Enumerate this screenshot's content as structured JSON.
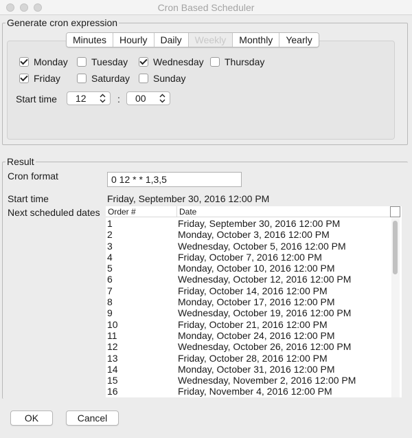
{
  "window": {
    "title": "Cron Based Scheduler"
  },
  "generate": {
    "title": "Generate cron expression",
    "tabs": [
      "Minutes",
      "Hourly",
      "Daily",
      "Weekly",
      "Monthly",
      "Yearly"
    ],
    "days": {
      "monday": "Monday",
      "tuesday": "Tuesday",
      "wednesday": "Wednesday",
      "thursday": "Thursday",
      "friday": "Friday",
      "saturday": "Saturday",
      "sunday": "Sunday"
    },
    "start_time_label": "Start time",
    "hour": "12",
    "separator": ":",
    "minute": "00"
  },
  "result": {
    "title": "Result",
    "cron_format_label": "Cron format",
    "cron_format_value": "0 12 * * 1,3,5",
    "start_time_label": "Start time",
    "start_time_value": "Friday, September 30, 2016 12:00 PM",
    "next_dates_label": "Next scheduled dates",
    "table": {
      "columns": [
        "Order #",
        "Date"
      ],
      "rows": [
        [
          "1",
          "Friday, September 30, 2016 12:00 PM"
        ],
        [
          "2",
          "Monday, October 3, 2016 12:00 PM"
        ],
        [
          "3",
          "Wednesday, October 5, 2016 12:00 PM"
        ],
        [
          "4",
          "Friday, October 7, 2016 12:00 PM"
        ],
        [
          "5",
          "Monday, October 10, 2016 12:00 PM"
        ],
        [
          "6",
          "Wednesday, October 12, 2016 12:00 PM"
        ],
        [
          "7",
          "Friday, October 14, 2016 12:00 PM"
        ],
        [
          "8",
          "Monday, October 17, 2016 12:00 PM"
        ],
        [
          "9",
          "Wednesday, October 19, 2016 12:00 PM"
        ],
        [
          "10",
          "Friday, October 21, 2016 12:00 PM"
        ],
        [
          "11",
          "Monday, October 24, 2016 12:00 PM"
        ],
        [
          "12",
          "Wednesday, October 26, 2016 12:00 PM"
        ],
        [
          "13",
          "Friday, October 28, 2016 12:00 PM"
        ],
        [
          "14",
          "Monday, October 31, 2016 12:00 PM"
        ],
        [
          "15",
          "Wednesday, November 2, 2016 12:00 PM"
        ],
        [
          "16",
          "Friday, November 4, 2016 12:00 PM"
        ]
      ]
    }
  },
  "buttons": {
    "ok": "OK",
    "cancel": "Cancel"
  }
}
